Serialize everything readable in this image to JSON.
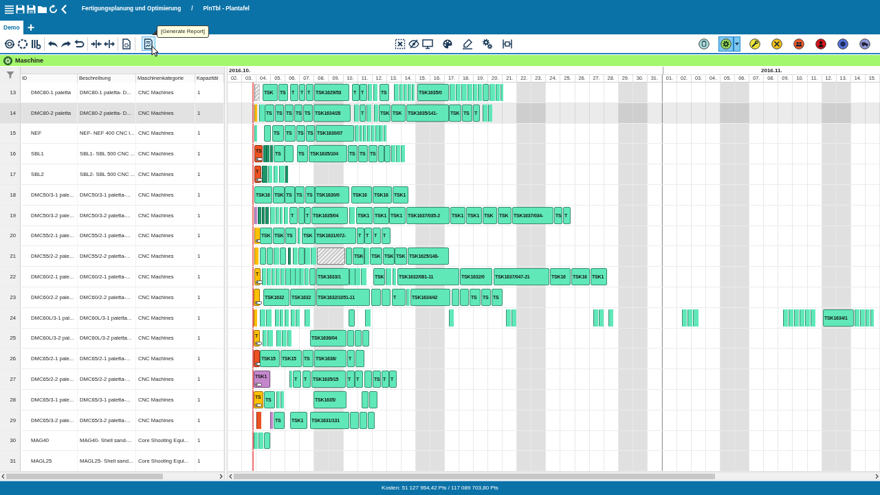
{
  "title_bar": {
    "breadcrumb": [
      "Fertigungsplanung und Optimierung",
      "PlnTbl - Plantafel"
    ],
    "separator": "/"
  },
  "tabs": [
    {
      "label": "Demo",
      "selected": true
    }
  ],
  "toolbar": {
    "report_button": {
      "hovered": true,
      "tooltip": "[Generate Report]"
    },
    "resource_filters": [
      {
        "selected": false
      },
      {
        "selected": true
      },
      {
        "selected": false
      },
      {
        "selected": false
      },
      {
        "selected": false
      },
      {
        "selected": false
      },
      {
        "selected": false
      },
      {
        "selected": false
      }
    ]
  },
  "section": {
    "title": "Maschine"
  },
  "timeline": {
    "months": [
      {
        "label": "2016.10.",
        "days": [
          {
            "label": "02.",
            "weekend": false
          },
          {
            "label": "03.",
            "weekend": false
          },
          {
            "label": "04.",
            "weekend": false
          },
          {
            "label": "05.",
            "weekend": false
          },
          {
            "label": "06.",
            "weekend": false
          },
          {
            "label": "07.",
            "weekend": false
          },
          {
            "label": "08.",
            "weekend": true
          },
          {
            "label": "09.",
            "weekend": true
          },
          {
            "label": "10.",
            "weekend": false
          },
          {
            "label": "11.",
            "weekend": false
          },
          {
            "label": "12.",
            "weekend": false
          },
          {
            "label": "13.",
            "weekend": false
          },
          {
            "label": "14.",
            "weekend": false
          },
          {
            "label": "15.",
            "weekend": true
          },
          {
            "label": "16.",
            "weekend": true
          },
          {
            "label": "17.",
            "weekend": false
          },
          {
            "label": "18.",
            "weekend": false
          },
          {
            "label": "19.",
            "weekend": false
          },
          {
            "label": "20.",
            "weekend": false
          },
          {
            "label": "21.",
            "weekend": false
          },
          {
            "label": "22.",
            "weekend": true
          },
          {
            "label": "23.",
            "weekend": true
          },
          {
            "label": "24.",
            "weekend": false
          },
          {
            "label": "25.",
            "weekend": false
          },
          {
            "label": "26.",
            "weekend": false
          },
          {
            "label": "27.",
            "weekend": false
          },
          {
            "label": "28.",
            "weekend": false
          },
          {
            "label": "29.",
            "weekend": true
          },
          {
            "label": "30.",
            "weekend": true
          },
          {
            "label": "31.",
            "weekend": false
          }
        ]
      },
      {
        "label": "2016.11.",
        "days": [
          {
            "label": "01.",
            "weekend": false
          },
          {
            "label": "02.",
            "weekend": false
          },
          {
            "label": "03.",
            "weekend": false
          },
          {
            "label": "04.",
            "weekend": false
          },
          {
            "label": "05.",
            "weekend": true
          },
          {
            "label": "06.",
            "weekend": true
          },
          {
            "label": "07.",
            "weekend": false
          },
          {
            "label": "08.",
            "weekend": false
          },
          {
            "label": "09.",
            "weekend": false
          },
          {
            "label": "10.",
            "weekend": false
          },
          {
            "label": "11.",
            "weekend": false
          },
          {
            "label": "12.",
            "weekend": true
          },
          {
            "label": "13.",
            "weekend": true
          },
          {
            "label": "14.",
            "weekend": false
          },
          {
            "label": "15.",
            "weekend": false
          }
        ]
      }
    ]
  },
  "table": {
    "columns": [
      "ID",
      "Beschreibung",
      "Maschinenkategorie",
      "Kapazität"
    ],
    "rows": [
      {
        "number": "13",
        "cells": [
          "DMC80-1 paletta",
          "DMC80-1 paletta- D...",
          "CNC Machines",
          "1"
        ],
        "selected": false,
        "bars": [
          {
            "kind": "setup",
            "color": "#c9c9c9"
          },
          {
            "kind": "task",
            "color": "#60e8b9",
            "label": "TSK"
          },
          {
            "kind": "task",
            "color": "#60e8b9",
            "label": "TS"
          },
          {
            "kind": "task",
            "color": "#60e8b9",
            "label": "T"
          },
          {
            "kind": "task",
            "color": "#60e8b9",
            "label": "T"
          },
          {
            "kind": "task",
            "color": "#60e8b9",
            "label": "T"
          },
          {
            "kind": "task",
            "color": "#60e8b9",
            "label": "TSK1629/53"
          },
          {
            "kind": "task",
            "color": "#60e8b9",
            "label": "T"
          },
          {
            "kind": "task",
            "color": "#60e8b9",
            "label": "T"
          },
          {
            "kind": "task",
            "color": "#60e8b9"
          },
          {
            "kind": "task",
            "color": "#60e8b9"
          },
          {
            "kind": "task",
            "color": "#60e8b9",
            "label": "TS"
          },
          {
            "kind": "task",
            "color": "#60e8b9"
          },
          {
            "kind": "task",
            "color": "#60e8b9"
          },
          {
            "kind": "task",
            "color": "#60e8b9"
          },
          {
            "kind": "task",
            "color": "#60e8b9"
          },
          {
            "kind": "task",
            "color": "#60e8b9"
          },
          {
            "kind": "task",
            "color": "#60e8b9",
            "label": "TSK1635/0"
          },
          {
            "kind": "task",
            "color": "#60e8b9"
          },
          {
            "kind": "task",
            "color": "#60e8b9"
          },
          {
            "kind": "task",
            "color": "#60e8b9"
          },
          {
            "kind": "task",
            "color": "#60e8b9"
          },
          {
            "kind": "task",
            "color": "#60e8b9"
          },
          {
            "kind": "task",
            "color": "#60e8b9"
          },
          {
            "kind": "task",
            "color": "#60e8b9"
          },
          {
            "kind": "task",
            "color": "#60e8b9"
          },
          {
            "kind": "task",
            "color": "#60e8b9"
          },
          {
            "kind": "task",
            "color": "#60e8b9"
          }
        ]
      },
      {
        "number": "14",
        "cells": [
          "DMC80-2 paletta",
          "DMC80-2 paletta- D...",
          "CNC Machines",
          "1"
        ],
        "selected": true,
        "bars": [
          {
            "kind": "task",
            "color": "#ffc000"
          },
          {
            "kind": "task",
            "color": "#60e8b9"
          },
          {
            "kind": "task",
            "color": "#60e8b9",
            "label": "TS"
          },
          {
            "kind": "task",
            "color": "#60e8b9",
            "label": "TS"
          },
          {
            "kind": "task",
            "color": "#60e8b9",
            "label": "TS"
          },
          {
            "kind": "task",
            "color": "#60e8b9",
            "label": "TS"
          },
          {
            "kind": "task",
            "color": "#60e8b9",
            "label": "TS"
          },
          {
            "kind": "task",
            "color": "#60e8b9",
            "label": "TSK1634/28"
          },
          {
            "kind": "task",
            "color": "#60e8b9"
          },
          {
            "kind": "task",
            "color": "#60e8b9",
            "label": "T"
          },
          {
            "kind": "task",
            "color": "#60e8b9"
          },
          {
            "kind": "task",
            "color": "#60e8b9"
          },
          {
            "kind": "task",
            "color": "#60e8b9",
            "label": "TSK"
          },
          {
            "kind": "task",
            "color": "#60e8b9",
            "label": "TSK"
          },
          {
            "kind": "task",
            "color": "#60e8b9",
            "label": "TSK1635/141-"
          },
          {
            "kind": "task",
            "color": "#60e8b9",
            "label": "TSK"
          },
          {
            "kind": "task",
            "color": "#60e8b9",
            "label": "TS"
          },
          {
            "kind": "task",
            "color": "#60e8b9",
            "label": "T"
          },
          {
            "kind": "task",
            "color": "#60e8b9"
          },
          {
            "kind": "task",
            "color": "#60e8b9"
          }
        ]
      },
      {
        "number": "15",
        "cells": [
          "NEF",
          "NEF- NEF 400 CNC l...",
          "CNC Machines",
          "1"
        ],
        "selected": false,
        "bars": [
          {
            "kind": "task",
            "color": "#60e8b9"
          },
          {
            "kind": "task",
            "color": "#60e8b9"
          },
          {
            "kind": "task",
            "color": "#60e8b9",
            "label": "TS"
          },
          {
            "kind": "task",
            "color": "#60e8b9",
            "label": "TS"
          },
          {
            "kind": "task",
            "color": "#60e8b9",
            "label": "TS"
          },
          {
            "kind": "task",
            "color": "#60e8b9",
            "label": "TS"
          },
          {
            "kind": "task",
            "color": "#60e8b9",
            "label": "TSK1630/07"
          },
          {
            "kind": "task",
            "color": "#60e8b9"
          },
          {
            "kind": "task",
            "color": "#60e8b9"
          },
          {
            "kind": "task",
            "color": "#60e8b9"
          },
          {
            "kind": "task",
            "color": "#60e8b9"
          },
          {
            "kind": "task",
            "color": "#60e8b9"
          },
          {
            "kind": "task",
            "color": "#60e8b9"
          },
          {
            "kind": "task",
            "color": "#60e8b9"
          },
          {
            "kind": "task",
            "color": "#60e8b9"
          }
        ]
      },
      {
        "number": "16",
        "cells": [
          "SBL1",
          "SBL1- SBL 500 CNC ...",
          "CNC Machines",
          "1"
        ],
        "selected": false,
        "bars": [
          {
            "kind": "flagged",
            "color": "#ec5121",
            "label": "TS"
          },
          {
            "kind": "task",
            "color": "#1e9468"
          },
          {
            "kind": "task",
            "color": "#1e9468"
          },
          {
            "kind": "task",
            "color": "#1e9468"
          },
          {
            "kind": "task",
            "color": "#60e8b9",
            "label": "TS"
          },
          {
            "kind": "task",
            "color": "#60e8b9"
          },
          {
            "kind": "task",
            "color": "#60e8b9",
            "label": "TS"
          },
          {
            "kind": "task",
            "color": "#60e8b9",
            "label": "TSK1635/104"
          },
          {
            "kind": "task",
            "color": "#60e8b9",
            "label": "TS"
          },
          {
            "kind": "task",
            "color": "#60e8b9",
            "label": "TS"
          },
          {
            "kind": "task",
            "color": "#60e8b9",
            "label": "TS"
          },
          {
            "kind": "task",
            "color": "#60e8b9"
          },
          {
            "kind": "task",
            "color": "#60e8b9"
          },
          {
            "kind": "task",
            "color": "#60e8b9"
          },
          {
            "kind": "task",
            "color": "#60e8b9"
          },
          {
            "kind": "task",
            "color": "#60e8b9"
          }
        ]
      },
      {
        "number": "17",
        "cells": [
          "SBL2",
          "SBL2- SBL 500 CNC ...",
          "CNC Machines",
          "1"
        ],
        "selected": false,
        "bars": [
          {
            "kind": "flagged",
            "color": "#ec5121",
            "label": "T"
          },
          {
            "kind": "task",
            "color": "#1e9468"
          },
          {
            "kind": "task",
            "color": "#60e8b9"
          },
          {
            "kind": "task",
            "color": "#60e8b9"
          },
          {
            "kind": "task",
            "color": "#60e8b9"
          },
          {
            "kind": "task",
            "color": "#1e9468"
          }
        ]
      },
      {
        "number": "18",
        "cells": [
          "DMC50/3-1 pale...",
          "DMC50/3-1 paletta-...",
          "CNC Machines",
          "1"
        ],
        "selected": false,
        "bars": [
          {
            "kind": "task",
            "color": "#60e8b9",
            "label": "TSK16"
          },
          {
            "kind": "task",
            "color": "#60e8b9",
            "label": "TSK"
          },
          {
            "kind": "task",
            "color": "#60e8b9",
            "label": "TS"
          },
          {
            "kind": "task",
            "color": "#60e8b9",
            "label": "TS"
          },
          {
            "kind": "task",
            "color": "#60e8b9",
            "label": "TS"
          },
          {
            "kind": "task",
            "color": "#60e8b9",
            "label": "TSK1630/0"
          },
          {
            "kind": "task",
            "color": "#60e8b9",
            "label": "TSK16"
          },
          {
            "kind": "task",
            "color": "#60e8b9",
            "label": "TSK16"
          },
          {
            "kind": "task",
            "color": "#60e8b9",
            "label": "TSK1"
          }
        ]
      },
      {
        "number": "19",
        "cells": [
          "DMC50/3-2 pale...",
          "DMC50/3-2 paletta-...",
          "CNC Machines",
          "1"
        ],
        "selected": false,
        "bars": [
          {
            "kind": "task",
            "color": "#c487cc"
          },
          {
            "kind": "task",
            "color": "#1e9468"
          },
          {
            "kind": "task",
            "color": "#1e9468"
          },
          {
            "kind": "task",
            "color": "#1e9468"
          },
          {
            "kind": "task",
            "color": "#60e8b9"
          },
          {
            "kind": "task",
            "color": "#60e8b9"
          },
          {
            "kind": "task",
            "color": "#60e8b9"
          },
          {
            "kind": "task",
            "color": "#60e8b9"
          },
          {
            "kind": "task",
            "color": "#60e8b9",
            "label": "T"
          },
          {
            "kind": "task",
            "color": "#60e8b9"
          },
          {
            "kind": "task",
            "color": "#60e8b9",
            "label": "T"
          },
          {
            "kind": "task",
            "color": "#60e8b9",
            "label": "TSK1635/04"
          },
          {
            "kind": "task",
            "color": "#60e8b9"
          },
          {
            "kind": "task",
            "color": "#60e8b9",
            "label": "TSK1"
          },
          {
            "kind": "task",
            "color": "#60e8b9",
            "label": "TSK1"
          },
          {
            "kind": "task",
            "color": "#60e8b9",
            "label": "TSK1"
          },
          {
            "kind": "task",
            "color": "#60e8b9",
            "label": "TSK1637/035-2"
          },
          {
            "kind": "task",
            "color": "#60e8b9",
            "label": "TSK1"
          },
          {
            "kind": "task",
            "color": "#60e8b9",
            "label": "TSK1"
          },
          {
            "kind": "task",
            "color": "#60e8b9",
            "label": "TSK"
          },
          {
            "kind": "task",
            "color": "#60e8b9",
            "label": "TSK"
          },
          {
            "kind": "task",
            "color": "#60e8b9",
            "label": "TSK1637/034-"
          },
          {
            "kind": "task",
            "color": "#60e8b9",
            "label": "TS"
          },
          {
            "kind": "task",
            "color": "#60e8b9",
            "label": "T"
          }
        ]
      },
      {
        "number": "20",
        "cells": [
          "DMC55/2-1 pale...",
          "DMC55/2-1 paletta-...",
          "CNC Machines",
          "1"
        ],
        "selected": false,
        "bars": [
          {
            "kind": "flagged",
            "color": "#ffc000"
          },
          {
            "kind": "task",
            "color": "#60e8b9",
            "label": "TSK"
          },
          {
            "kind": "task",
            "color": "#60e8b9",
            "label": "TSK"
          },
          {
            "kind": "task",
            "color": "#60e8b9",
            "label": "TS"
          },
          {
            "kind": "task",
            "color": "#60e8b9"
          },
          {
            "kind": "task",
            "color": "#60e8b9",
            "label": "TSK"
          },
          {
            "kind": "task",
            "color": "#60e8b9",
            "label": "TSK1631/072-"
          },
          {
            "kind": "task",
            "color": "#60e8b9",
            "label": "T"
          },
          {
            "kind": "task",
            "color": "#60e8b9",
            "label": "T"
          },
          {
            "kind": "task",
            "color": "#60e8b9",
            "label": "T"
          },
          {
            "kind": "task",
            "color": "#60e8b9",
            "label": "T"
          }
        ]
      },
      {
        "number": "21",
        "cells": [
          "DMC55/2-2 pale...",
          "DMC55/2-2 paletta-...",
          "CNC Machines",
          "1"
        ],
        "selected": false,
        "bars": [
          {
            "kind": "task",
            "color": "#ffc000"
          },
          {
            "kind": "task",
            "color": "#60e8b9"
          },
          {
            "kind": "task",
            "color": "#60e8b9"
          },
          {
            "kind": "task",
            "color": "#60e8b9"
          },
          {
            "kind": "task",
            "color": "#60e8b9"
          },
          {
            "kind": "task",
            "color": "#1e9468"
          },
          {
            "kind": "task",
            "color": "#60e8b9"
          },
          {
            "kind": "task",
            "color": "#60e8b9"
          },
          {
            "kind": "task",
            "color": "#60e8b9"
          },
          {
            "kind": "task",
            "color": "#60e8b9"
          },
          {
            "kind": "setup",
            "color": "#c9c9c9"
          },
          {
            "kind": "task",
            "color": "#60e8b9"
          },
          {
            "kind": "task",
            "color": "#60e8b9",
            "label": "TSK"
          },
          {
            "kind": "task",
            "color": "#60e8b9"
          },
          {
            "kind": "task",
            "color": "#60e8b9",
            "label": "TSK"
          },
          {
            "kind": "task",
            "color": "#60e8b9",
            "label": "TSK"
          },
          {
            "kind": "task",
            "color": "#60e8b9",
            "label": "TSK"
          },
          {
            "kind": "task",
            "color": "#60e8b9",
            "label": "TSK1625/148-"
          }
        ]
      },
      {
        "number": "22",
        "cells": [
          "DMC60/2-1 pale...",
          "DMC60/2-1 paletta-...",
          "CNC Machines",
          "1"
        ],
        "selected": false,
        "bars": [
          {
            "kind": "flagged",
            "color": "#ffc000",
            "label": "T"
          },
          {
            "kind": "task",
            "color": "#60e8b9"
          },
          {
            "kind": "task",
            "color": "#60e8b9"
          },
          {
            "kind": "task",
            "color": "#60e8b9"
          },
          {
            "kind": "task",
            "color": "#60e8b9"
          },
          {
            "kind": "task",
            "color": "#60e8b9"
          },
          {
            "kind": "task",
            "color": "#60e8b9"
          },
          {
            "kind": "task",
            "color": "#60e8b9"
          },
          {
            "kind": "task",
            "color": "#60e8b9"
          },
          {
            "kind": "task",
            "color": "#60e8b9"
          },
          {
            "kind": "task",
            "color": "#60e8b9"
          },
          {
            "kind": "task",
            "color": "#60e8b9"
          },
          {
            "kind": "task",
            "color": "#60e8b9",
            "label": "TSK1633/1"
          },
          {
            "kind": "task",
            "color": "#60e8b9"
          },
          {
            "kind": "task",
            "color": "#60e8b9"
          },
          {
            "kind": "task",
            "color": "#60e8b9"
          },
          {
            "kind": "task",
            "color": "#60e8b9",
            "label": "TSK"
          },
          {
            "kind": "task",
            "color": "#60e8b9"
          },
          {
            "kind": "task",
            "color": "#60e8b9"
          },
          {
            "kind": "task",
            "color": "#60e8b9",
            "label": "TSK1632/081-11"
          },
          {
            "kind": "task",
            "color": "#60e8b9",
            "label": "TSK1632/0"
          },
          {
            "kind": "task",
            "color": "#60e8b9",
            "label": "TSK1637/047-21"
          },
          {
            "kind": "task",
            "color": "#60e8b9",
            "label": "TSK16"
          },
          {
            "kind": "task",
            "color": "#60e8b9",
            "label": "TSK16"
          },
          {
            "kind": "task",
            "color": "#60e8b9",
            "label": "TSK1"
          }
        ]
      },
      {
        "number": "23",
        "cells": [
          "DMC60/2-2 pale...",
          "DMC60/2-2 paletta-...",
          "CNC Machines",
          "1"
        ],
        "selected": false,
        "bars": [
          {
            "kind": "flagged",
            "color": "#ffc000"
          },
          {
            "kind": "task",
            "color": "#60e8b9",
            "label": "TSK1632"
          },
          {
            "kind": "task",
            "color": "#60e8b9",
            "label": "TSK1632"
          },
          {
            "kind": "task",
            "color": "#60e8b9",
            "label": "TSK1632/1051-11"
          },
          {
            "kind": "task",
            "color": "#60e8b9"
          },
          {
            "kind": "task",
            "color": "#60e8b9"
          },
          {
            "kind": "task",
            "color": "#60e8b9",
            "label": "T"
          },
          {
            "kind": "task",
            "color": "#60e8b9"
          },
          {
            "kind": "task",
            "color": "#60e8b9",
            "label": "TSK1634/42"
          },
          {
            "kind": "task",
            "color": "#60e8b9"
          },
          {
            "kind": "task",
            "color": "#60e8b9"
          },
          {
            "kind": "task",
            "color": "#60e8b9",
            "label": "TS"
          },
          {
            "kind": "task",
            "color": "#60e8b9",
            "label": "TS"
          },
          {
            "kind": "task",
            "color": "#60e8b9",
            "label": "TS"
          }
        ]
      },
      {
        "number": "24",
        "cells": [
          "DMC60L/3-1 pal...",
          "DMC60L/3-1 paletta...",
          "CNC Machines",
          "1"
        ],
        "selected": false,
        "bars": [
          {
            "kind": "task",
            "color": "#ffc000"
          },
          {
            "kind": "task",
            "color": "#60e8b9"
          },
          {
            "kind": "task",
            "color": "#60e8b9"
          },
          {
            "kind": "task",
            "color": "#60e8b9"
          },
          {
            "kind": "task",
            "color": "#60e8b9"
          },
          {
            "kind": "task",
            "color": "#60e8b9"
          },
          {
            "kind": "task",
            "color": "#60e8b9"
          },
          {
            "kind": "task",
            "color": "#60e8b9"
          },
          {
            "kind": "task",
            "color": "#60e8b9"
          },
          {
            "kind": "task",
            "color": "#60e8b9"
          },
          {
            "kind": "task",
            "color": "#60e8b9"
          },
          {
            "kind": "task",
            "color": "#60e8b9"
          },
          {
            "kind": "task",
            "color": "#60e8b9"
          },
          {
            "kind": "task",
            "color": "#60e8b9"
          },
          {
            "kind": "task",
            "color": "#60e8b9"
          },
          {
            "kind": "task",
            "color": "#60e8b9"
          },
          {
            "kind": "task",
            "color": "#60e8b9"
          },
          {
            "kind": "task",
            "color": "#60e8b9"
          },
          {
            "kind": "task",
            "color": "#60e8b9"
          },
          {
            "kind": "task",
            "color": "#60e8b9"
          },
          {
            "kind": "task",
            "color": "#60e8b9"
          },
          {
            "kind": "task",
            "color": "#60e8b9"
          },
          {
            "kind": "task",
            "color": "#60e8b9"
          },
          {
            "kind": "task",
            "color": "#60e8b9"
          },
          {
            "kind": "task",
            "color": "#60e8b9"
          },
          {
            "kind": "task",
            "color": "#60e8b9"
          },
          {
            "kind": "task",
            "color": "#60e8b9",
            "label": "TSK1634/1"
          },
          {
            "kind": "task",
            "color": "#60e8b9"
          },
          {
            "kind": "task",
            "color": "#60e8b9"
          },
          {
            "kind": "task",
            "color": "#60e8b9"
          },
          {
            "kind": "task",
            "color": "#60e8b9"
          }
        ]
      },
      {
        "number": "25",
        "cells": [
          "DMC60L/3-2 pal...",
          "DMC60L/3-2 paletta...",
          "CNC Machines",
          "1"
        ],
        "selected": false,
        "bars": [
          {
            "kind": "flagged",
            "color": "#ffc000",
            "label": "T"
          },
          {
            "kind": "task",
            "color": "#60e8b9"
          },
          {
            "kind": "task",
            "color": "#60e8b9"
          },
          {
            "kind": "task",
            "color": "#60e8b9"
          },
          {
            "kind": "task",
            "color": "#60e8b9"
          },
          {
            "kind": "task",
            "color": "#60e8b9"
          },
          {
            "kind": "task",
            "color": "#60e8b9",
            "label": "TSK1636/04"
          },
          {
            "kind": "task",
            "color": "#60e8b9"
          },
          {
            "kind": "task",
            "color": "#60e8b9"
          },
          {
            "kind": "task",
            "color": "#60e8b9"
          }
        ]
      },
      {
        "number": "26",
        "cells": [
          "DMC65/2-1 pale...",
          "DMC65/2-1 paletta-...",
          "CNC Machines",
          "1"
        ],
        "selected": false,
        "bars": [
          {
            "kind": "flagged",
            "color": "#ec5121"
          },
          {
            "kind": "task",
            "color": "#60e8b9",
            "label": "TSK15"
          },
          {
            "kind": "task",
            "color": "#60e8b9",
            "label": "TSK15"
          },
          {
            "kind": "task",
            "color": "#60e8b9",
            "label": "TS"
          },
          {
            "kind": "task",
            "color": "#60e8b9",
            "label": "TSK1636/"
          },
          {
            "kind": "task",
            "color": "#60e8b9",
            "label": "T"
          },
          {
            "kind": "task",
            "color": "#60e8b9"
          }
        ]
      },
      {
        "number": "27",
        "cells": [
          "DMC65/2-2 pale...",
          "DMC65/2-2 paletta-...",
          "CNC Machines",
          "1"
        ],
        "selected": false,
        "bars": [
          {
            "kind": "flagged",
            "color": "#c487cc",
            "label": "TSK1"
          },
          {
            "kind": "task",
            "color": "#60e8b9"
          },
          {
            "kind": "task",
            "color": "#60e8b9",
            "label": "T"
          },
          {
            "kind": "task",
            "color": "#60e8b9",
            "label": "T"
          },
          {
            "kind": "task",
            "color": "#60e8b9",
            "label": "TSK1635/15"
          },
          {
            "kind": "task",
            "color": "#60e8b9",
            "label": "T"
          },
          {
            "kind": "task",
            "color": "#60e8b9",
            "label": "T"
          },
          {
            "kind": "task",
            "color": "#60e8b9"
          },
          {
            "kind": "task",
            "color": "#60e8b9",
            "label": "TS"
          },
          {
            "kind": "task",
            "color": "#60e8b9",
            "label": "T"
          },
          {
            "kind": "task",
            "color": "#60e8b9",
            "label": "T"
          }
        ]
      },
      {
        "number": "28",
        "cells": [
          "DMC65/3-1 pale...",
          "DMC65/3-1 paletta-...",
          "CNC Machines",
          "1"
        ],
        "selected": false,
        "bars": [
          {
            "kind": "flagged",
            "color": "#ffc000",
            "label": "TS"
          },
          {
            "kind": "task",
            "color": "#60e8b9",
            "label": "TS"
          },
          {
            "kind": "task",
            "color": "#60e8b9"
          },
          {
            "kind": "task",
            "color": "#60e8b9"
          },
          {
            "kind": "task",
            "color": "#60e8b9",
            "label": "TSK1635/"
          },
          {
            "kind": "task",
            "color": "#60e8b9"
          },
          {
            "kind": "task",
            "color": "#60e8b9"
          }
        ]
      },
      {
        "number": "29",
        "cells": [
          "DMC65/3-2 pale...",
          "DMC65/3-2 paletta-...",
          "CNC Machines",
          "1"
        ],
        "selected": false,
        "bars": [
          {
            "kind": "task",
            "color": "#ec5121"
          },
          {
            "kind": "task",
            "color": "#c487cc"
          },
          {
            "kind": "task",
            "color": "#60e8b9",
            "label": "TS"
          },
          {
            "kind": "task",
            "color": "#60e8b9",
            "label": "TSK1"
          },
          {
            "kind": "task",
            "color": "#60e8b9",
            "label": "TSK1631/131"
          },
          {
            "kind": "task",
            "color": "#60e8b9"
          },
          {
            "kind": "task",
            "color": "#60e8b9"
          },
          {
            "kind": "task",
            "color": "#60e8b9"
          }
        ]
      },
      {
        "number": "30",
        "cells": [
          "MAG40",
          "MAG40- Shell sand-...",
          "Core Shooting Equi...",
          "1"
        ],
        "selected": false,
        "bars": [
          {
            "kind": "task",
            "color": "#60e8b9"
          },
          {
            "kind": "task",
            "color": "#60e8b9"
          },
          {
            "kind": "task",
            "color": "#60e8b9"
          }
        ]
      },
      {
        "number": "31",
        "cells": [
          "MAGL25",
          "MAGL25- Shell sand...",
          "Core Shooting Equi...",
          "1"
        ],
        "selected": false
      }
    ]
  },
  "status_bar": {
    "text": "Kosten: 51 127 954,42 Pts / 117 089 703,80 Pts"
  }
}
